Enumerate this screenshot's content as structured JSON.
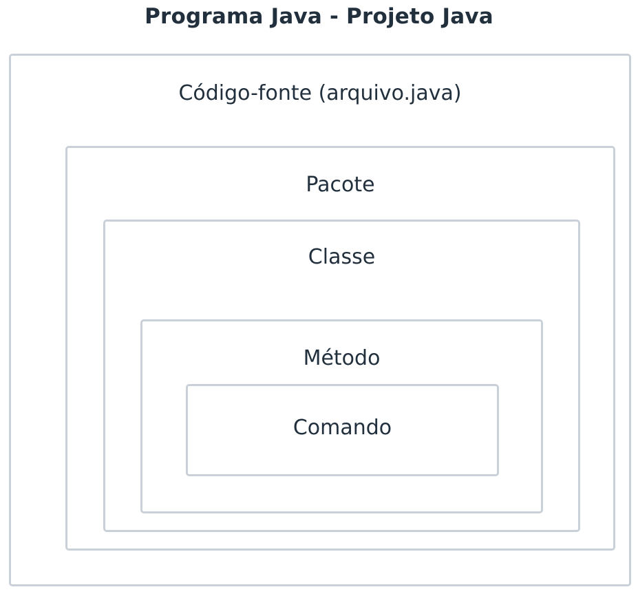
{
  "title": "Programa Java - Projeto Java",
  "boxes": {
    "codigo_fonte": "Código-fonte (arquivo.java)",
    "pacote": "Pacote",
    "classe": "Classe",
    "metodo": "Método",
    "comando": "Comando"
  },
  "colors": {
    "border": "#c9d0d8",
    "text": "#22303d",
    "background": "#ffffff"
  }
}
